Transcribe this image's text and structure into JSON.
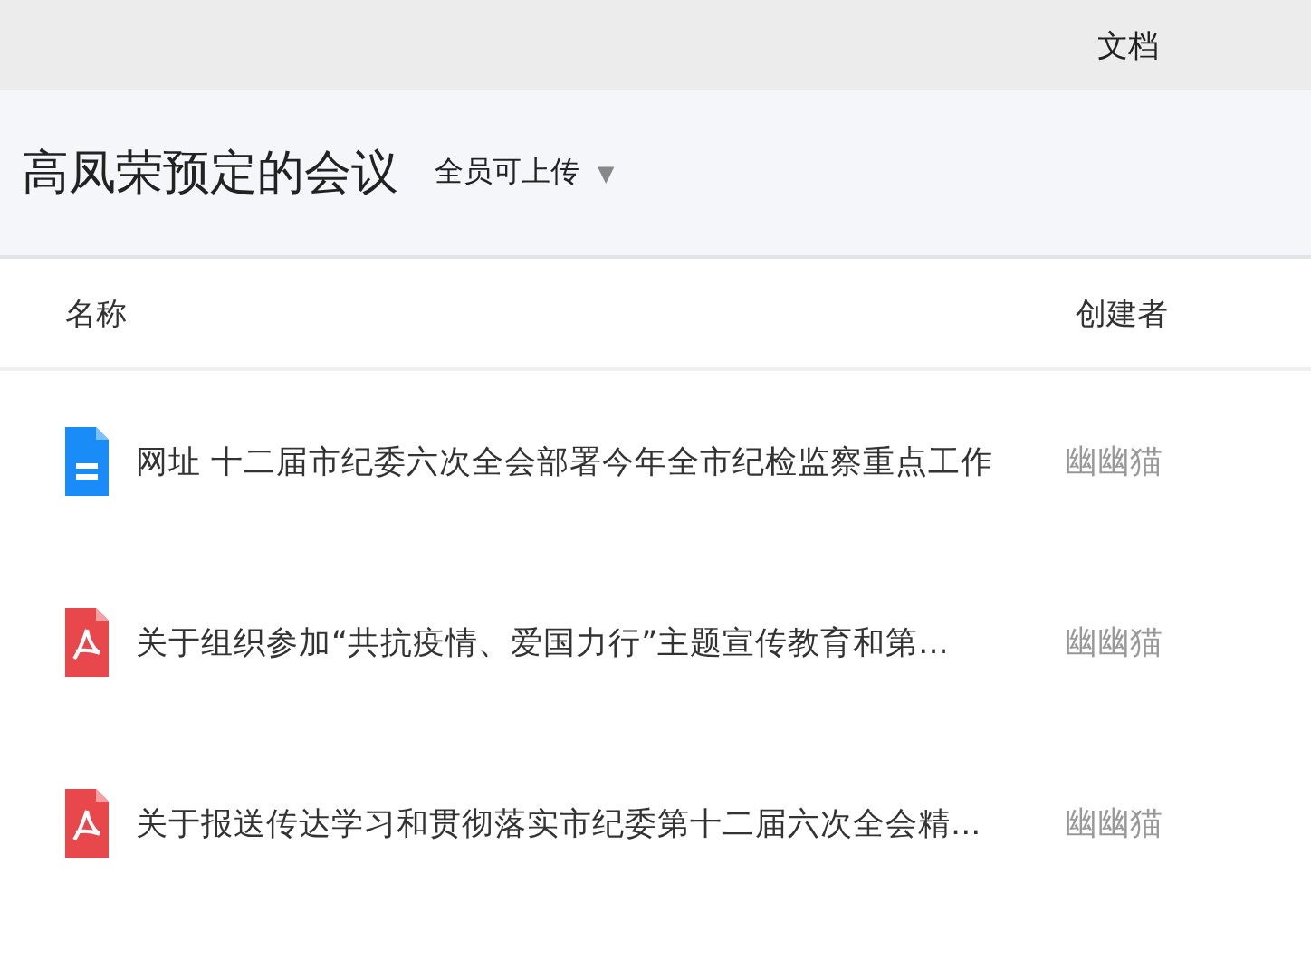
{
  "top_bar": {
    "tab": "文档"
  },
  "header": {
    "title": "高凤荣预定的会议",
    "permission": "全员可上传",
    "dropdown_arrow": "▼"
  },
  "table": {
    "columns": [
      "名称",
      "创建者"
    ],
    "rows": [
      {
        "kind": "doc",
        "name": "网址 十二届市纪委六次全会部署今年全市纪检监察重点工作",
        "creator": "幽幽猫"
      },
      {
        "kind": "pdf",
        "name": "关于组织参加“共抗疫情、爱国力行”主题宣传教育和第...",
        "creator": "幽幽猫"
      },
      {
        "kind": "pdf",
        "name": "关于报送传达学习和贯彻落实市纪委第十二届六次全会精...",
        "creator": "幽幽猫"
      }
    ]
  }
}
